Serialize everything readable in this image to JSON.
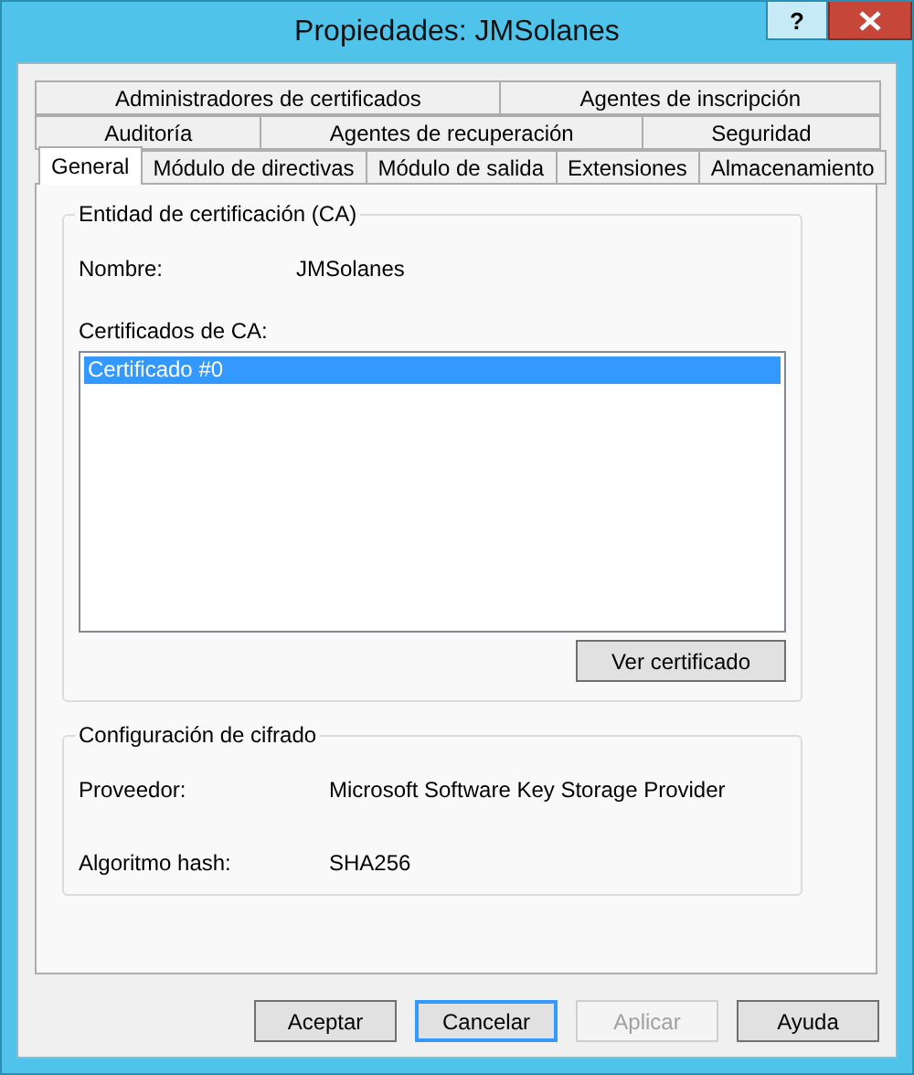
{
  "window": {
    "title": "Propiedades: JMSolanes",
    "help_button": "?"
  },
  "tab_rows": [
    [
      {
        "label": "Administradores de certificados",
        "selected": false
      },
      {
        "label": "Agentes de inscripción",
        "selected": false
      }
    ],
    [
      {
        "label": "Auditoría",
        "selected": false
      },
      {
        "label": "Agentes de recuperación",
        "selected": false
      },
      {
        "label": "Seguridad",
        "selected": false
      }
    ],
    [
      {
        "label": "General",
        "selected": true
      },
      {
        "label": "Módulo de directivas",
        "selected": false
      },
      {
        "label": "Módulo de salida",
        "selected": false
      },
      {
        "label": "Extensiones",
        "selected": false
      },
      {
        "label": "Almacenamiento",
        "selected": false
      }
    ]
  ],
  "ca_group": {
    "legend": "Entidad de certificación (CA)",
    "name_label": "Nombre:",
    "name_value": "JMSolanes",
    "certs_label": "Certificados de CA:",
    "certificates": [
      {
        "label": "Certificado #0",
        "selected": true
      }
    ],
    "view_button": "Ver certificado"
  },
  "crypto_group": {
    "legend": "Configuración de cifrado",
    "rows": [
      {
        "label": "Proveedor:",
        "value": "Microsoft Software Key Storage Provider"
      },
      {
        "label": "Algoritmo hash:",
        "value": "SHA256"
      }
    ]
  },
  "buttons": [
    {
      "label": "Aceptar",
      "disabled": false,
      "focused": false
    },
    {
      "label": "Cancelar",
      "disabled": false,
      "focused": true
    },
    {
      "label": "Aplicar",
      "disabled": true,
      "focused": false
    },
    {
      "label": "Ayuda",
      "disabled": false,
      "focused": false
    }
  ]
}
